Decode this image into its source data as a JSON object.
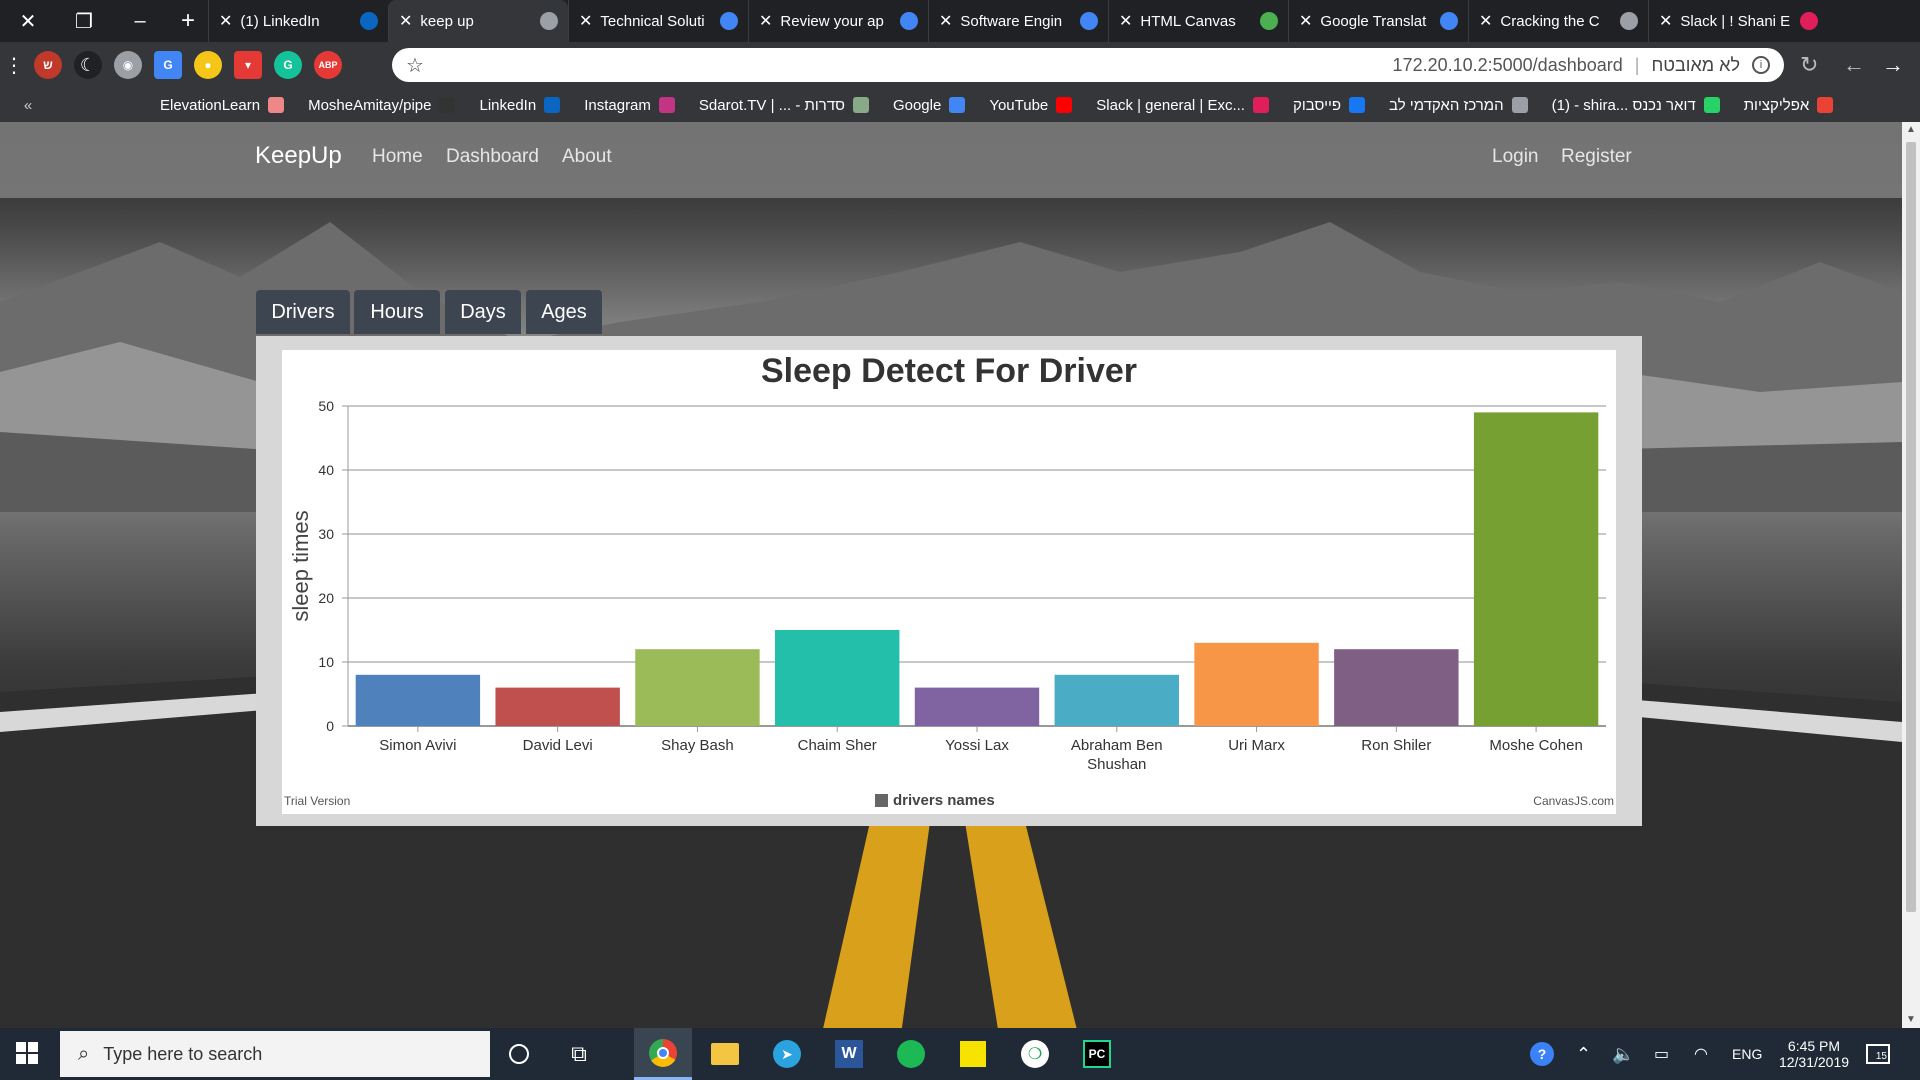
{
  "browser": {
    "tabs": [
      {
        "title": "(1) LinkedIn",
        "favicon": "linkedin-icon",
        "color": "#0a66c2",
        "active": false
      },
      {
        "title": "keep up",
        "favicon": "globe-icon",
        "color": "#9aa0a6",
        "active": true
      },
      {
        "title": "Technical Soluti",
        "favicon": "google-icon",
        "color": "#4285f4",
        "active": false
      },
      {
        "title": "Review your ap",
        "favicon": "google-icon",
        "color": "#4285f4",
        "active": false
      },
      {
        "title": "Software Engin",
        "favicon": "google-icon",
        "color": "#4285f4",
        "active": false
      },
      {
        "title": "HTML Canvas",
        "favicon": "w3schools-icon",
        "color": "#4caf50",
        "active": false
      },
      {
        "title": "Google Translat",
        "favicon": "translate-icon",
        "color": "#4285f4",
        "active": false
      },
      {
        "title": "Cracking the C",
        "favicon": "globe-icon",
        "color": "#9aa0a6",
        "active": false
      },
      {
        "title": "Slack | ! Shani E",
        "favicon": "slack-icon",
        "color": "#e01e5a",
        "active": false
      }
    ],
    "address": {
      "url": "172.20.10.2:5000/dashboard",
      "security_label": "לא מאובטח"
    },
    "bookmarks": [
      {
        "label": "ElevationLearn",
        "color": "#e88"
      },
      {
        "label": "MosheAmitay/pipe",
        "color": "#333"
      },
      {
        "label": "LinkedIn",
        "color": "#0a66c2"
      },
      {
        "label": "Instagram",
        "color": "#c13584"
      },
      {
        "label": "Sdarot.TV | ... - סדרות",
        "color": "#8a8"
      },
      {
        "label": "Google",
        "color": "#4285f4"
      },
      {
        "label": "YouTube",
        "color": "#ff0000"
      },
      {
        "label": "Slack | general | Exc...",
        "color": "#e01e5a"
      },
      {
        "label": "פייסבוק",
        "color": "#1877f2"
      },
      {
        "label": "המרכז האקדמי לב",
        "color": "#9aa0a6"
      },
      {
        "label": "(1) - shira... דואר נכנס",
        "color": "#25d366"
      },
      {
        "label": "אפליקציות",
        "color": "#ea4335"
      }
    ]
  },
  "site": {
    "brand": "KeepUp",
    "nav": {
      "home": "Home",
      "dashboard": "Dashboard",
      "about": "About",
      "login": "Login",
      "register": "Register"
    },
    "chart_tabs": [
      "Drivers",
      "Hours",
      "Days",
      "Ages"
    ]
  },
  "chart_data": {
    "type": "bar",
    "title": "Sleep Detect For Driver",
    "ylabel": "sleep times",
    "xlabel": "",
    "ylim": [
      0,
      50
    ],
    "yticks": [
      0,
      10,
      20,
      30,
      40,
      50
    ],
    "grid": true,
    "legend": "bottom",
    "categories": [
      "Simon Avivi",
      "David Levi",
      "Shay Bash",
      "Chaim Sher",
      "Yossi Lax",
      "Abraham Ben Shushan",
      "Uri Marx",
      "Ron Shiler",
      "Moshe Cohen"
    ],
    "series": [
      {
        "name": "drivers names",
        "values": [
          8,
          6,
          12,
          15,
          6,
          8,
          13,
          12,
          49
        ],
        "colors": [
          "#4f81bc",
          "#c0504e",
          "#9bbb58",
          "#23bfaa",
          "#8064a1",
          "#4aacc5",
          "#f79647",
          "#7f6084",
          "#77a033"
        ]
      }
    ],
    "watermark_left": "Trial Version",
    "watermark_right": "CanvasJS.com"
  },
  "taskbar": {
    "search_placeholder": "Type here to search",
    "time": "6:45 PM",
    "date": "12/31/2019",
    "language": "ENG",
    "notification_count": "15"
  }
}
